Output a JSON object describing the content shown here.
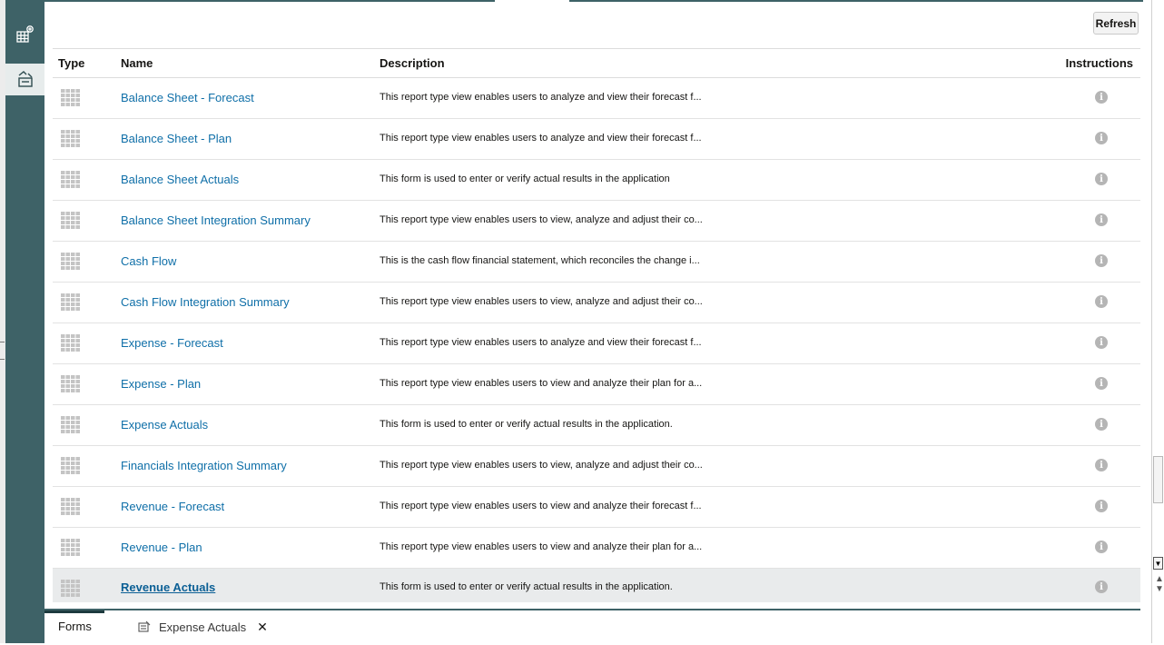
{
  "toolbar": {
    "refresh_label": "Refresh"
  },
  "table": {
    "headers": {
      "type": "Type",
      "name": "Name",
      "description": "Description",
      "instructions": "Instructions"
    },
    "rows": [
      {
        "name": "Balance Sheet - Forecast",
        "description": "This report type view enables users to analyze and view their forecast f...",
        "selected": false
      },
      {
        "name": "Balance Sheet - Plan",
        "description": "This report type view enables users to analyze and view their forecast f...",
        "selected": false
      },
      {
        "name": "Balance Sheet Actuals",
        "description": "This form is used to enter or verify actual results in the application",
        "selected": false
      },
      {
        "name": "Balance Sheet Integration Summary",
        "description": "This report type view enables users to view, analyze and adjust their co...",
        "selected": false
      },
      {
        "name": "Cash Flow",
        "description": "This is the cash flow financial statement, which reconciles the change i...",
        "selected": false
      },
      {
        "name": "Cash Flow Integration Summary",
        "description": "This report type view enables users to view, analyze and adjust their co...",
        "selected": false
      },
      {
        "name": "Expense - Forecast",
        "description": "This report type view enables users to analyze and view their forecast f...",
        "selected": false
      },
      {
        "name": "Expense - Plan",
        "description": "This report type view enables users to view and analyze their plan for a...",
        "selected": false
      },
      {
        "name": "Expense Actuals",
        "description": "This form is used to enter or verify actual results in the application.",
        "selected": false
      },
      {
        "name": "Financials Integration Summary",
        "description": "This report type view enables users to view, analyze and adjust their co...",
        "selected": false
      },
      {
        "name": "Revenue - Forecast",
        "description": "This report type view enables users to view and analyze their forecast f...",
        "selected": false
      },
      {
        "name": "Revenue - Plan",
        "description": "This report type view enables users to view and analyze their plan for a...",
        "selected": false
      },
      {
        "name": "Revenue Actuals",
        "description": "This form is used to enter or verify actual results in the application.",
        "selected": true
      }
    ],
    "type_icon": "grid-form-icon",
    "info_icon": "info-icon",
    "info_glyph": "i"
  },
  "bottom_tabs": {
    "forms_label": "Forms",
    "open_doc_label": "Expense Actuals",
    "close_glyph": "✕"
  },
  "colors": {
    "rail": "#3e6267",
    "link": "#0f6fa8",
    "selected_row": "#e9ebec"
  }
}
